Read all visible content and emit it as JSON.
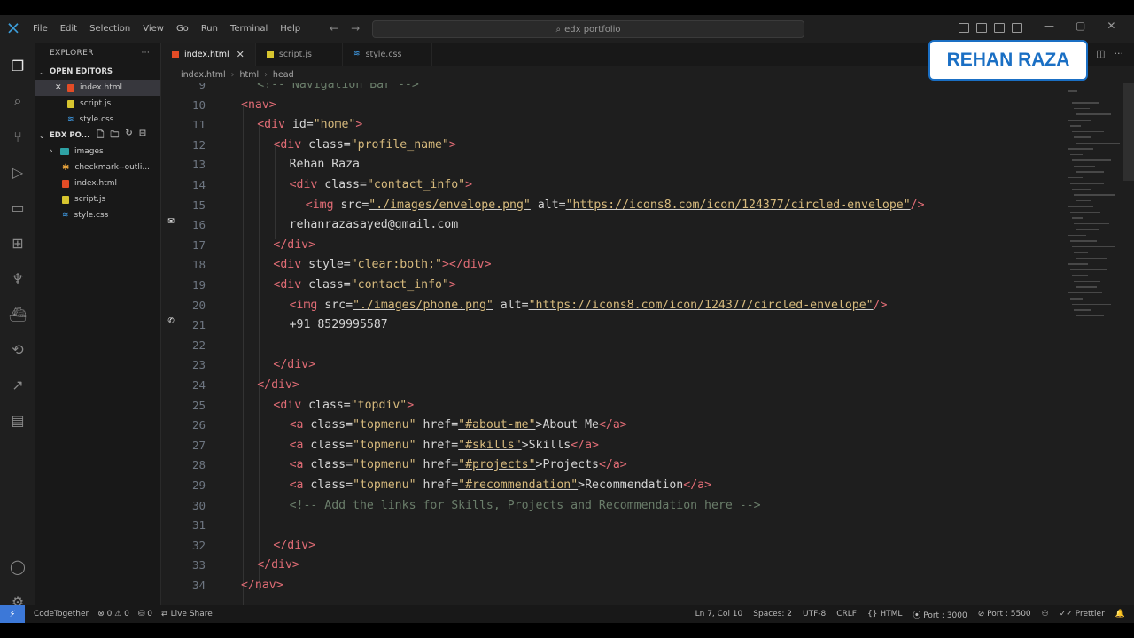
{
  "window": {
    "menu": [
      "File",
      "Edit",
      "Selection",
      "View",
      "Go",
      "Run",
      "Terminal",
      "Help"
    ],
    "search": "edx portfolio"
  },
  "activity_icons": [
    "explorer-icon",
    "search-icon",
    "source-control-icon",
    "run-debug-icon",
    "remote-explorer-icon",
    "extensions-icon",
    "python-icon",
    "docker-icon",
    "live-share-icon",
    "deploy-icon",
    "chat-icon",
    "account-icon",
    "settings-gear-icon"
  ],
  "sidebar": {
    "title": "EXPLORER",
    "open_editors_label": "OPEN EDITORS",
    "open_editors": [
      {
        "name": "index.html",
        "type": "html"
      },
      {
        "name": "script.js",
        "type": "js"
      },
      {
        "name": "style.css",
        "type": "css"
      }
    ],
    "project_label": "EDX PO...",
    "project_items": [
      {
        "name": "images",
        "type": "folder"
      },
      {
        "name": "checkmark--outli...",
        "type": "star"
      },
      {
        "name": "index.html",
        "type": "html"
      },
      {
        "name": "script.js",
        "type": "js"
      },
      {
        "name": "style.css",
        "type": "css"
      }
    ]
  },
  "tabs": [
    {
      "label": "index.html",
      "type": "html",
      "active": true
    },
    {
      "label": "script.js",
      "type": "js",
      "active": false
    },
    {
      "label": "style.css",
      "type": "css",
      "active": false
    }
  ],
  "breadcrumb": [
    "index.html",
    "html",
    "head"
  ],
  "code_lines": [
    {
      "n": "9",
      "tokens": [
        [
          "cmt",
          "<!-- Navigation Bar -->"
        ]
      ]
    },
    {
      "n": "10",
      "tokens": [
        [
          "tag",
          "<nav>"
        ]
      ]
    },
    {
      "n": "11",
      "tokens": [
        [
          "tag",
          "<div "
        ],
        [
          "attr",
          "id="
        ],
        [
          "str",
          "\"home\""
        ],
        [
          "tag",
          ">"
        ]
      ]
    },
    {
      "n": "12",
      "tokens": [
        [
          "tag",
          "<div "
        ],
        [
          "attr",
          "class="
        ],
        [
          "str",
          "\"profile_name\""
        ],
        [
          "tag",
          ">"
        ]
      ]
    },
    {
      "n": "13",
      "tokens": [
        [
          "attr",
          "Rehan Raza"
        ]
      ]
    },
    {
      "n": "14",
      "tokens": [
        [
          "tag",
          "<div "
        ],
        [
          "attr",
          "class="
        ],
        [
          "str",
          "\"contact_info\""
        ],
        [
          "tag",
          ">"
        ]
      ]
    },
    {
      "n": "15",
      "tokens": [
        [
          "tag",
          "<img "
        ],
        [
          "attr",
          "src="
        ],
        [
          "str",
          "\"./images/envelope.png\""
        ],
        [
          "attr",
          " alt="
        ],
        [
          "str",
          "\"https://icons8.com/icon/124377/circled-envelope\""
        ],
        [
          "tag",
          "/>"
        ]
      ]
    },
    {
      "n": "16",
      "tokens": [
        [
          "attr",
          "rehanrazasayed@gmail.com"
        ]
      ]
    },
    {
      "n": "17",
      "tokens": [
        [
          "tag",
          "</div>"
        ]
      ]
    },
    {
      "n": "18",
      "tokens": [
        [
          "tag",
          "<div "
        ],
        [
          "attr",
          "style="
        ],
        [
          "str",
          "\"clear:both;\""
        ],
        [
          "tag",
          "></div>"
        ]
      ]
    },
    {
      "n": "19",
      "tokens": [
        [
          "tag",
          "<div "
        ],
        [
          "attr",
          "class="
        ],
        [
          "str",
          "\"contact_info\""
        ],
        [
          "tag",
          ">"
        ]
      ]
    },
    {
      "n": "20",
      "tokens": [
        [
          "tag",
          "<img "
        ],
        [
          "attr",
          "src="
        ],
        [
          "str",
          "\"./images/phone.png\""
        ],
        [
          "attr",
          " alt="
        ],
        [
          "str",
          "\"https://icons8.com/icon/124377/circled-envelope\""
        ],
        [
          "tag",
          "/>"
        ]
      ]
    },
    {
      "n": "21",
      "tokens": [
        [
          "attr",
          "+91 8529995587"
        ]
      ]
    },
    {
      "n": "22",
      "tokens": []
    },
    {
      "n": "23",
      "tokens": [
        [
          "tag",
          "</div>"
        ]
      ]
    },
    {
      "n": "24",
      "tokens": [
        [
          "tag",
          "</div>"
        ]
      ]
    },
    {
      "n": "25",
      "tokens": [
        [
          "tag",
          "<div "
        ],
        [
          "attr",
          "class="
        ],
        [
          "str",
          "\"topdiv\""
        ],
        [
          "tag",
          ">"
        ]
      ]
    },
    {
      "n": "26",
      "tokens": [
        [
          "tag",
          "<a "
        ],
        [
          "attr",
          "class="
        ],
        [
          "str",
          "\"topmenu\""
        ],
        [
          "attr",
          " href="
        ],
        [
          "str",
          "\"#about-me\""
        ],
        [
          "attr",
          ">About Me"
        ],
        [
          "tag",
          "</a>"
        ]
      ]
    },
    {
      "n": "27",
      "tokens": [
        [
          "tag",
          "<a "
        ],
        [
          "attr",
          "class="
        ],
        [
          "str",
          "\"topmenu\""
        ],
        [
          "attr",
          " href="
        ],
        [
          "str",
          "\"#skills\""
        ],
        [
          "attr",
          ">Skills"
        ],
        [
          "tag",
          "</a>"
        ]
      ]
    },
    {
      "n": "28",
      "tokens": [
        [
          "tag",
          "<a "
        ],
        [
          "attr",
          "class="
        ],
        [
          "str",
          "\"topmenu\""
        ],
        [
          "attr",
          " href="
        ],
        [
          "str",
          "\"#projects\""
        ],
        [
          "attr",
          ">Projects"
        ],
        [
          "tag",
          "</a>"
        ]
      ]
    },
    {
      "n": "29",
      "tokens": [
        [
          "tag",
          "<a "
        ],
        [
          "attr",
          "class="
        ],
        [
          "str",
          "\"topmenu\""
        ],
        [
          "attr",
          " href="
        ],
        [
          "str",
          "\"#recommendation\""
        ],
        [
          "attr",
          ">Recommendation"
        ],
        [
          "tag",
          "</a>"
        ]
      ]
    },
    {
      "n": "30",
      "tokens": [
        [
          "cmt",
          "<!-- Add the links for Skills, Projects and Recommendation here -->"
        ]
      ]
    },
    {
      "n": "31",
      "tokens": []
    },
    {
      "n": "32",
      "tokens": [
        [
          "tag",
          "</div>"
        ]
      ]
    },
    {
      "n": "33",
      "tokens": [
        [
          "tag",
          "</div>"
        ]
      ]
    },
    {
      "n": "34",
      "tokens": [
        [
          "tag",
          "</nav>"
        ]
      ]
    }
  ],
  "status": {
    "codetogether": "CodeTogether",
    "problems": "⊗ 0 ⚠ 0",
    "ports": "⛁ 0",
    "liveshare": "Live Share",
    "cursor": "Ln 7, Col 10",
    "spaces": "Spaces: 2",
    "encoding": "UTF-8",
    "eol": "CRLF",
    "language": "HTML",
    "port": "Port : 3000",
    "port2": "Port : 5500",
    "prettier": "Prettier"
  },
  "overlay": {
    "name": "REHAN RAZA"
  },
  "colors": {
    "accent": "#3c9dd9",
    "tag": "#e06c75",
    "string": "#d7ba7d",
    "comment": "#6a7d6a",
    "badge": "#1a6fc4"
  }
}
